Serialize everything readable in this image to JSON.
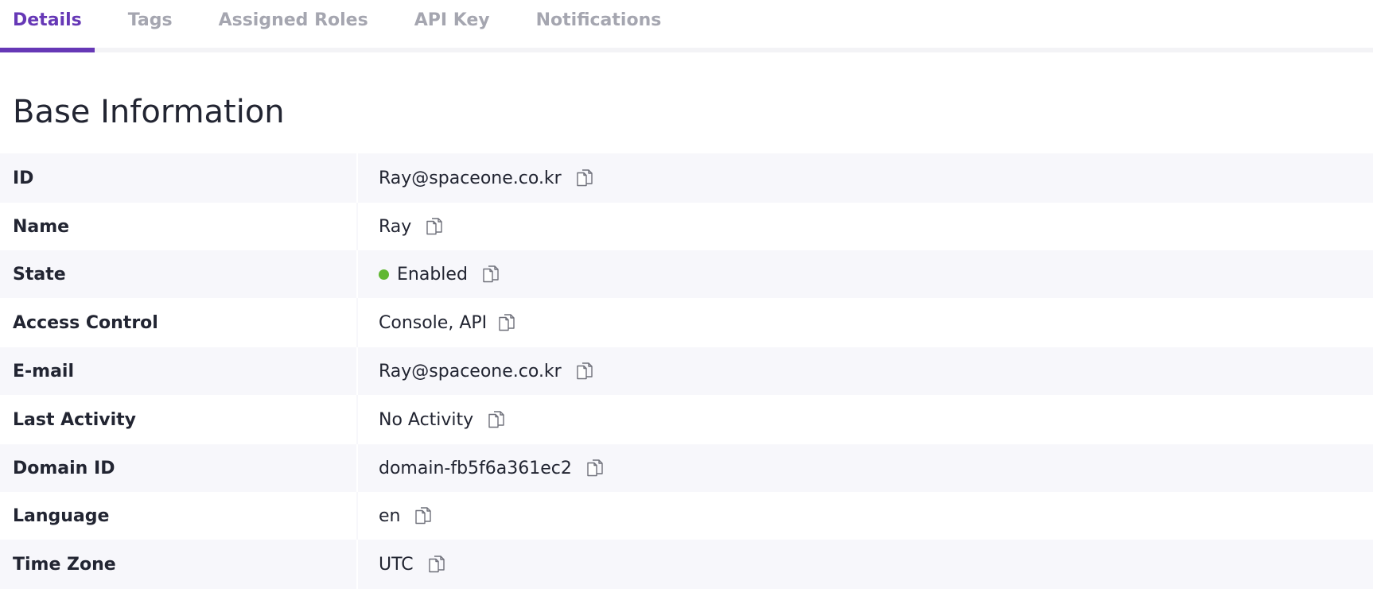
{
  "tabs": [
    {
      "label": "Details",
      "active": true
    },
    {
      "label": "Tags",
      "active": false
    },
    {
      "label": "Assigned Roles",
      "active": false
    },
    {
      "label": "API Key",
      "active": false
    },
    {
      "label": "Notifications",
      "active": false
    }
  ],
  "section": {
    "title": "Base Information"
  },
  "rows": [
    {
      "label": "ID",
      "value": "Ray@spaceone.co.kr"
    },
    {
      "label": "Name",
      "value": "Ray"
    },
    {
      "label": "State",
      "value": "Enabled",
      "status_color": "#60b731"
    },
    {
      "label": "Access Control",
      "value": "Console, API"
    },
    {
      "label": "E-mail",
      "value": "Ray@spaceone.co.kr"
    },
    {
      "label": "Last Activity",
      "value": "No Activity"
    },
    {
      "label": "Domain ID",
      "value": "domain-fb5f6a361ec2"
    },
    {
      "label": "Language",
      "value": "en"
    },
    {
      "label": "Time Zone",
      "value": "UTC"
    }
  ],
  "icons": {
    "copy": "copy-icon",
    "status": "status-dot-icon"
  },
  "colors": {
    "accent": "#6638b6",
    "enabled": "#60b731",
    "row_alt": "#f7f7fb"
  }
}
